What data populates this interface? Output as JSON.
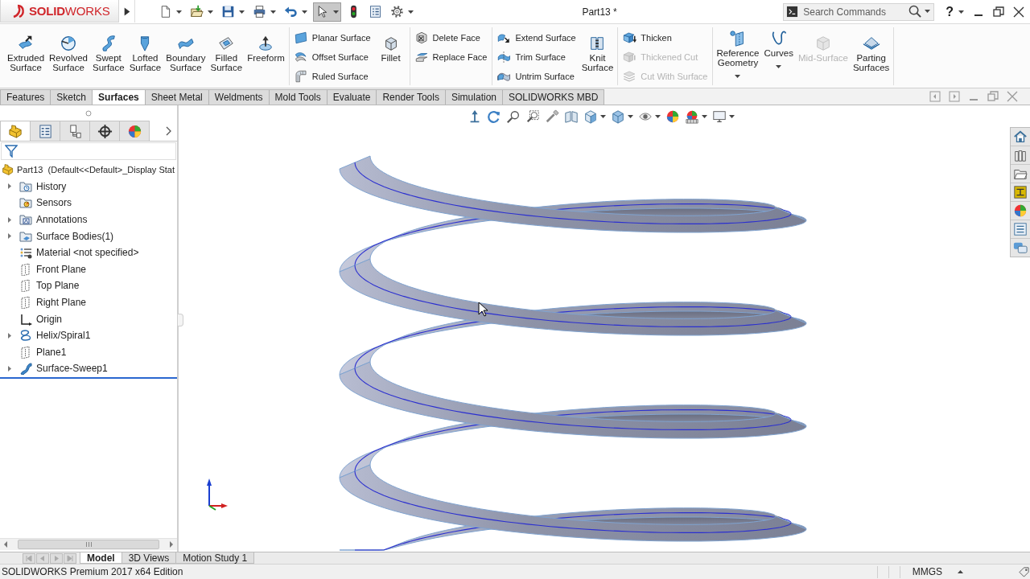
{
  "title_bar": {
    "logo": "**SOLID**WORKS",
    "document_title": "Part13 *",
    "search": {
      "placeholder": "Search Commands"
    },
    "help": "?"
  },
  "quick_access": [
    {
      "selected": false,
      "dropdown": true
    },
    {
      "selected": false,
      "dropdown": true
    },
    {
      "selected": false,
      "dropdown": true
    },
    {
      "selected": false,
      "dropdown": true
    },
    {
      "selected": false,
      "dropdown": true
    },
    {
      "selected": true,
      "dropdown": true
    },
    {
      "selected": false,
      "dropdown": false
    },
    {
      "selected": false,
      "dropdown": false
    },
    {
      "selected": false,
      "dropdown": true
    }
  ],
  "ribbon": {
    "groups": [
      {
        "items": [
          {
            "kind": "large",
            "lines": [
              "Extruded",
              "Surface"
            ],
            "disabled": false,
            "dropdown": false
          },
          {
            "kind": "large",
            "lines": [
              "Revolved",
              "Surface"
            ],
            "disabled": false,
            "dropdown": false
          },
          {
            "kind": "large",
            "lines": [
              "Swept",
              "Surface"
            ],
            "disabled": false,
            "dropdown": false
          },
          {
            "kind": "large",
            "lines": [
              "Lofted",
              "Surface"
            ],
            "disabled": false,
            "dropdown": false
          },
          {
            "kind": "large",
            "lines": [
              "Boundary",
              "Surface"
            ],
            "disabled": false,
            "dropdown": false
          },
          {
            "kind": "large",
            "lines": [
              "Filled",
              "Surface"
            ],
            "disabled": false,
            "dropdown": false
          },
          {
            "kind": "large",
            "lines": [
              "Freeform"
            ],
            "disabled": false,
            "dropdown": false
          }
        ]
      },
      {
        "items": [
          {
            "kind": "small",
            "label": "Planar Surface",
            "disabled": false,
            "dropdown": false
          },
          {
            "kind": "small",
            "label": "Offset Surface",
            "disabled": false,
            "dropdown": false
          },
          {
            "kind": "small",
            "label": "Ruled Surface",
            "disabled": false,
            "dropdown": false
          },
          {
            "kind": "large",
            "lines": [
              "Fillet"
            ],
            "disabled": false,
            "dropdown": false
          }
        ]
      },
      {
        "items": [
          {
            "kind": "small",
            "label": "Delete Face",
            "disabled": false,
            "dropdown": false
          },
          {
            "kind": "small",
            "label": "Replace Face",
            "disabled": false,
            "dropdown": false
          }
        ]
      },
      {
        "items": [
          {
            "kind": "small",
            "label": "Extend Surface",
            "disabled": false,
            "dropdown": false
          },
          {
            "kind": "small",
            "label": "Trim Surface",
            "disabled": false,
            "dropdown": false
          },
          {
            "kind": "small",
            "label": "Untrim Surface",
            "disabled": false,
            "dropdown": false
          },
          {
            "kind": "large",
            "lines": [
              "Knit",
              "Surface"
            ],
            "disabled": false,
            "dropdown": false
          }
        ]
      },
      {
        "items": [
          {
            "kind": "small",
            "label": "Thicken",
            "disabled": false,
            "dropdown": false
          },
          {
            "kind": "small",
            "label": "Thickened Cut",
            "disabled": true,
            "dropdown": false
          },
          {
            "kind": "small",
            "label": "Cut With Surface",
            "disabled": true,
            "dropdown": false
          }
        ]
      },
      {
        "items": [
          {
            "kind": "large",
            "lines": [
              "Reference",
              "Geometry"
            ],
            "disabled": false,
            "dropdown": true
          },
          {
            "kind": "large",
            "lines": [
              "Curves"
            ],
            "disabled": false,
            "dropdown": true
          },
          {
            "kind": "large",
            "lines": [
              "Mid-Surface"
            ],
            "disabled": true,
            "dropdown": false
          },
          {
            "kind": "large",
            "lines": [
              "Parting",
              "Surfaces"
            ],
            "disabled": false,
            "dropdown": false
          }
        ]
      }
    ]
  },
  "command_tabs": [
    {
      "label": "Features",
      "selected": false
    },
    {
      "label": "Sketch",
      "selected": false
    },
    {
      "label": "Surfaces",
      "selected": true
    },
    {
      "label": "Sheet Metal",
      "selected": false
    },
    {
      "label": "Weldments",
      "selected": false
    },
    {
      "label": "Mold Tools",
      "selected": false
    },
    {
      "label": "Evaluate",
      "selected": false
    },
    {
      "label": "Render Tools",
      "selected": false
    },
    {
      "label": "Simulation",
      "selected": false
    },
    {
      "label": "SOLIDWORKS MBD",
      "selected": false
    }
  ],
  "feature_manager": {
    "tabs": [
      {
        "selected": true
      },
      {
        "selected": false
      },
      {
        "selected": false
      },
      {
        "selected": false
      },
      {
        "selected": false
      }
    ],
    "tree": {
      "label": "Part13  (Default<<Default>_Display Stat",
      "kind": "part",
      "children": [
        {
          "label": "History",
          "kind": "history",
          "expanded": false
        },
        {
          "label": "Sensors",
          "kind": "sensors"
        },
        {
          "label": "Annotations",
          "kind": "annotations",
          "expanded": false
        },
        {
          "label": "Surface Bodies(1)",
          "kind": "bodies",
          "expanded": false
        },
        {
          "label": "Material <not specified>",
          "kind": "material"
        },
        {
          "label": "Front Plane",
          "kind": "plane"
        },
        {
          "label": "Top Plane",
          "kind": "plane"
        },
        {
          "label": "Right Plane",
          "kind": "plane"
        },
        {
          "label": "Origin",
          "kind": "origin"
        },
        {
          "label": "Helix/Spiral1",
          "kind": "helix",
          "expanded": false
        },
        {
          "label": "Plane1",
          "kind": "plane"
        },
        {
          "label": "Surface-Sweep1",
          "kind": "sweep",
          "expanded": false
        }
      ]
    }
  },
  "bottom_tabs": [
    {
      "label": "Model",
      "selected": true
    },
    {
      "label": "3D Views",
      "selected": false
    },
    {
      "label": "Motion Study 1",
      "selected": false
    }
  ],
  "status_bar": {
    "edition": "SOLIDWORKS Premium 2017 x64 Edition",
    "units": "MMGS"
  }
}
